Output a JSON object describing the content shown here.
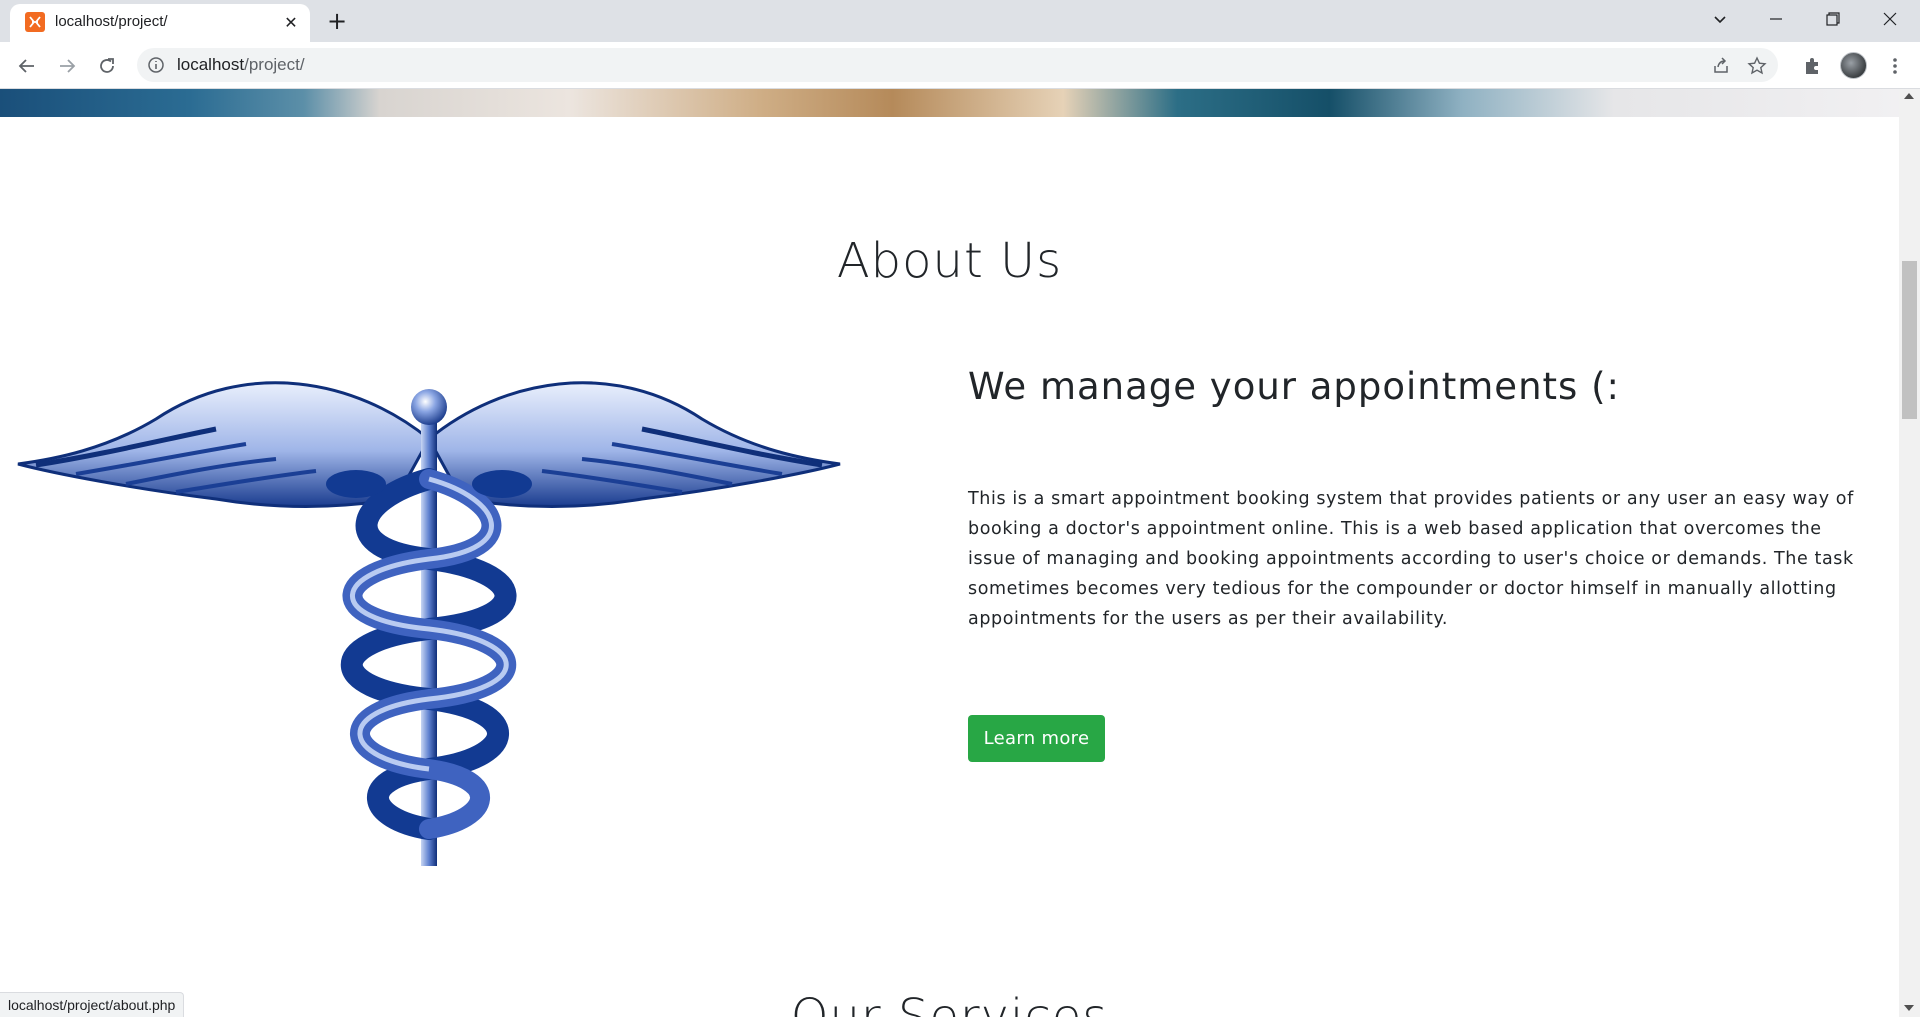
{
  "browser": {
    "tab_title": "localhost/project/",
    "tab_favicon": "xampp-icon",
    "url_host": "localhost",
    "url_path": "/project/",
    "status_url": "localhost/project/about.php"
  },
  "page": {
    "about_title": "About Us",
    "about_subtitle": "We manage your appointments (:",
    "about_text": "This is a smart appointment booking system that provides patients or any user an easy way of booking a doctor's appointment online. This is a web based application that overcomes the issue of managing and booking appointments according to user's choice or demands. The task sometimes becomes very tedious for the compounder or doctor himself in manually allotting appointments for the users as per their availability.",
    "learn_more_label": "Learn more",
    "services_title": "Our Services",
    "image_icon": "caduceus-icon"
  },
  "colors": {
    "button_bg": "#28a745",
    "caduceus_dark": "#0f2f7a",
    "caduceus_light": "#c9d7f5"
  }
}
